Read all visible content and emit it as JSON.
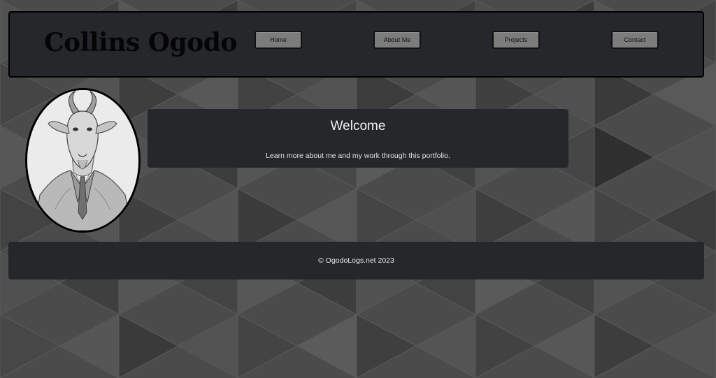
{
  "header": {
    "site_title": "Collins Ogodo",
    "nav": [
      {
        "label": "Home"
      },
      {
        "label": "About Me"
      },
      {
        "label": "Projects"
      },
      {
        "label": "Contact"
      }
    ]
  },
  "hero": {
    "image_subject": "goat-in-suit-portrait",
    "welcome_title": "Welcome",
    "welcome_text": "Learn more about me and my work through this portfolio."
  },
  "footer": {
    "copyright": "© OgodoLogs.net 2023"
  },
  "colors": {
    "panel": "#25272b",
    "button": "#7c7c7c",
    "background": "#4a4a4a",
    "text": "#f0f0f0"
  }
}
